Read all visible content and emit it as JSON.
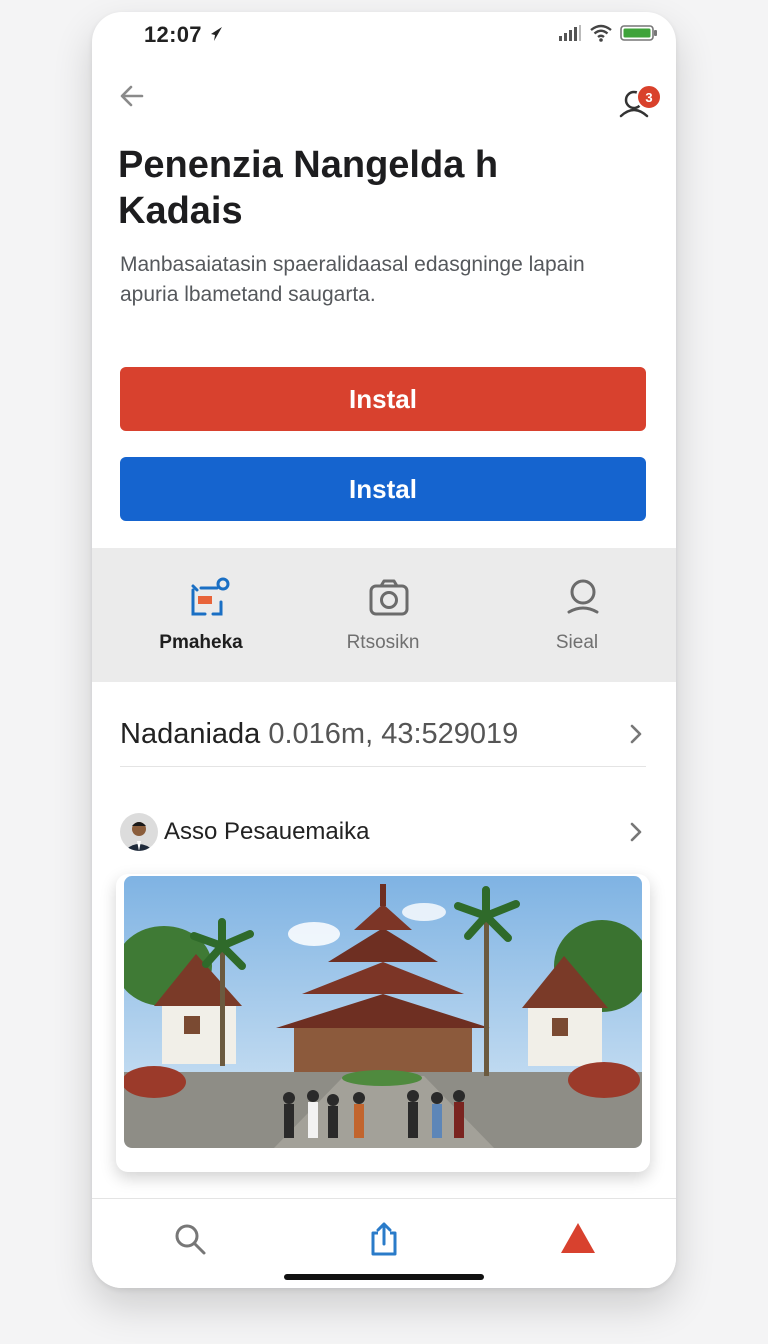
{
  "status_bar": {
    "time": "12:07"
  },
  "header": {
    "notification_count": "3",
    "title_line1": "Penenzia Nangelda h",
    "title_line2": "Kadais",
    "subtitle_line1": "Manbasaiatasin spaeralidaasal edasgninge lapain",
    "subtitle_line2": "apuria lbametand saugarta."
  },
  "actions": {
    "primary_label": "Instal",
    "secondary_label": "Instal"
  },
  "tabs": [
    {
      "label": "Pmaheka",
      "icon": "route-icon",
      "active": true
    },
    {
      "label": "Rtsosikn",
      "icon": "camera-icon",
      "active": false
    },
    {
      "label": "Sieal",
      "icon": "user-icon",
      "active": false
    }
  ],
  "info_row": {
    "label": "Nadaniada",
    "value": "0.016m, 43:529019"
  },
  "author": {
    "name": "Asso Pesauemaika"
  },
  "bottom_nav": [
    {
      "icon": "search-icon"
    },
    {
      "icon": "share-icon"
    },
    {
      "icon": "alert-icon"
    }
  ],
  "colors": {
    "primary_red": "#d8412e",
    "primary_blue": "#1564cf",
    "tab_strip_bg": "#ebebeb"
  }
}
